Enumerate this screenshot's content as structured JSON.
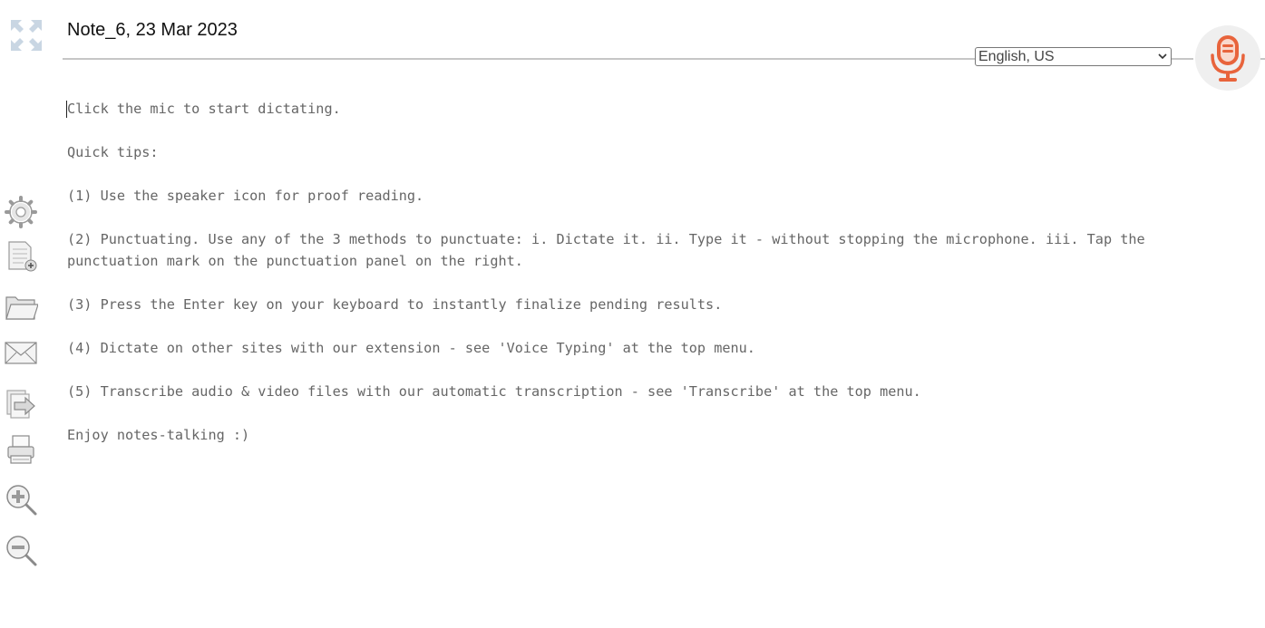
{
  "note": {
    "title": "Note_6, 23 Mar 2023"
  },
  "language": {
    "selected": "English, US"
  },
  "toolbar": {
    "items": [
      {
        "name": "settings",
        "icon": "gear-icon"
      },
      {
        "name": "new-note",
        "icon": "new-document-icon"
      },
      {
        "name": "open",
        "icon": "folder-icon"
      },
      {
        "name": "email",
        "icon": "envelope-icon"
      },
      {
        "name": "export",
        "icon": "export-arrow-icon"
      },
      {
        "name": "print",
        "icon": "printer-icon"
      },
      {
        "name": "zoom-in",
        "icon": "zoom-in-icon"
      },
      {
        "name": "zoom-out",
        "icon": "zoom-out-icon"
      }
    ]
  },
  "editor": {
    "lines": [
      "Click the mic to start dictating.",
      "Quick tips:",
      "(1) Use the speaker icon for proof reading.",
      "(2) Punctuating. Use any of the 3 methods to punctuate: i. Dictate it. ii. Type it - without stopping the microphone. iii. Tap the punctuation mark on the punctuation panel on the right.",
      "(3) Press the Enter key on your keyboard to instantly finalize pending results.",
      "(4) Dictate on other sites with our extension - see 'Voice Typing' at the top menu.",
      "(5) Transcribe audio & video files with our automatic transcription - see 'Transcribe' at the top menu.",
      "Enjoy notes-talking :)"
    ]
  },
  "colors": {
    "mic_accent": "#e8643c",
    "mic_bg": "#efefef",
    "text": "#666666",
    "rule": "#c6c6c6"
  }
}
